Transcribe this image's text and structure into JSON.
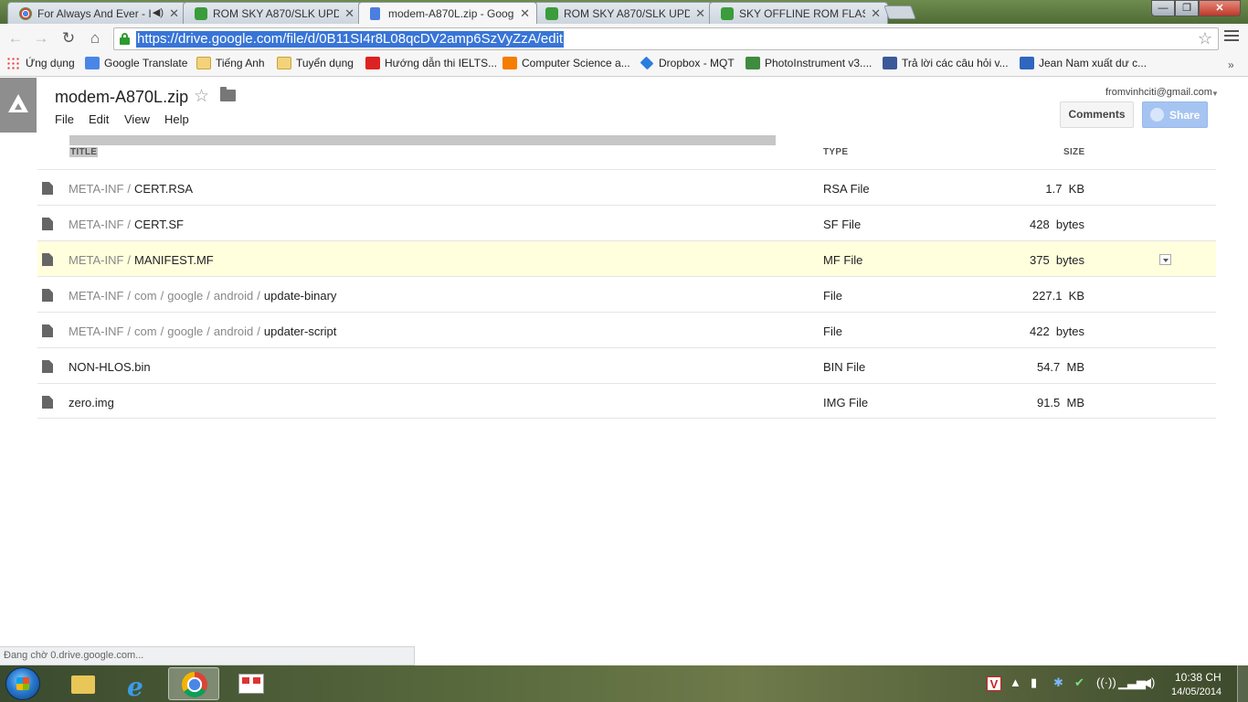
{
  "browser": {
    "tabs": [
      {
        "title": "For Always And Ever - I",
        "icon": "chrome-icon",
        "audio": true
      },
      {
        "title": "ROM SKY A870/SLK UPDA",
        "icon": "phone-icon"
      },
      {
        "title": "modem-A870L.zip - Goog",
        "icon": "drive-doc-icon",
        "active": true
      },
      {
        "title": "ROM SKY A870/SLK UPDA",
        "icon": "phone-icon"
      },
      {
        "title": "SKY OFFLINE ROM FLASH",
        "icon": "phone-icon"
      }
    ],
    "url": "https://drive.google.com/file/d/0B11SI4r8L08qcDV2amp6SzVyZzA/edit",
    "bookmarks": [
      {
        "label": "Ứng dụng",
        "icon": "apps-icon"
      },
      {
        "label": "Google Translate",
        "icon": "translate-icon"
      },
      {
        "label": "Tiếng Anh",
        "icon": "folder-icon"
      },
      {
        "label": "Tuyển dụng",
        "icon": "folder-icon"
      },
      {
        "label": "Hướng dẫn thi IELTS...",
        "icon": "youtube-icon"
      },
      {
        "label": "Computer Science a...",
        "icon": "blogger-icon"
      },
      {
        "label": "Dropbox - MQT",
        "icon": "dropbox-icon"
      },
      {
        "label": "PhotoInstrument v3....",
        "icon": "photoinstrument-icon"
      },
      {
        "label": "Trả lời các câu hỏi v...",
        "icon": "facebook-icon"
      },
      {
        "label": "Jean Nam xuất dư c...",
        "icon": "jean-icon"
      }
    ],
    "more_bookmarks": "»"
  },
  "drive": {
    "doc_title": "modem-A870L.zip",
    "menu": [
      "File",
      "Edit",
      "View",
      "Help"
    ],
    "account": "fromvinhciti@gmail.com",
    "comments_label": "Comments",
    "share_label": "Share",
    "columns": {
      "title": "TITLE",
      "type": "TYPE",
      "size": "SIZE"
    },
    "files": [
      {
        "path": [
          "META-INF"
        ],
        "name": "CERT.RSA",
        "type": "RSA File",
        "size": "1.7  KB"
      },
      {
        "path": [
          "META-INF"
        ],
        "name": "CERT.SF",
        "type": "SF File",
        "size": "428  bytes"
      },
      {
        "path": [
          "META-INF"
        ],
        "name": "MANIFEST.MF",
        "type": "MF File",
        "size": "375  bytes",
        "highlighted": true
      },
      {
        "path": [
          "META-INF",
          "com",
          "google",
          "android"
        ],
        "name": "update-binary",
        "type": "File",
        "size": "227.1  KB"
      },
      {
        "path": [
          "META-INF",
          "com",
          "google",
          "android"
        ],
        "name": "updater-script",
        "type": "File",
        "size": "422  bytes"
      },
      {
        "path": [],
        "name": "NON-HLOS.bin",
        "type": "BIN File",
        "size": "54.7  MB"
      },
      {
        "path": [],
        "name": "zero.img",
        "type": "IMG File",
        "size": "91.5  MB"
      }
    ],
    "path_separator": "/"
  },
  "status_text": "Đang chờ 0.drive.google.com...",
  "taskbar": {
    "apps": [
      "windows-explorer-icon",
      "internet-explorer-icon",
      "chrome-icon",
      "unikey-icon"
    ],
    "clock_time": "10:38 CH",
    "clock_date": "14/05/2014"
  }
}
